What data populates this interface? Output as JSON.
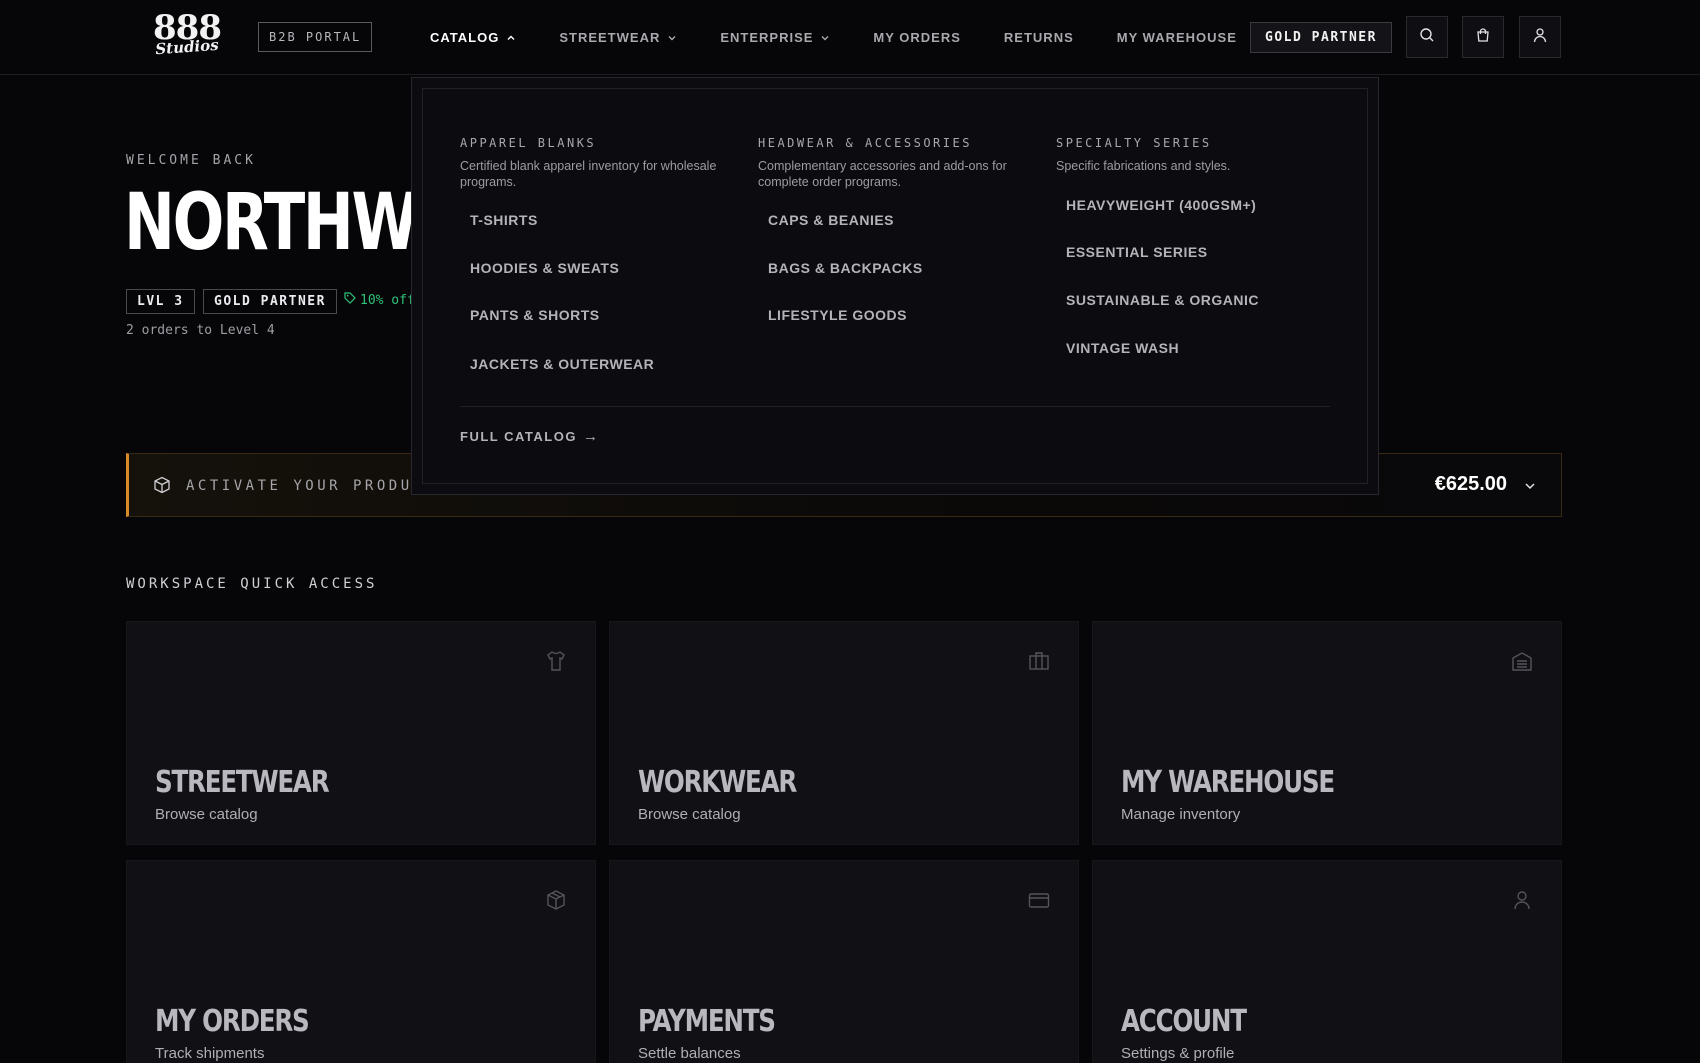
{
  "header": {
    "logo": {
      "line1": "888",
      "line2": "Studios"
    },
    "portal_badge": "B2B PORTAL",
    "nav": [
      {
        "label": "CATALOG",
        "has_dropdown": true,
        "open": true
      },
      {
        "label": "STREETWEAR",
        "has_dropdown": true
      },
      {
        "label": "ENTERPRISE",
        "has_dropdown": true
      },
      {
        "label": "MY ORDERS"
      },
      {
        "label": "RETURNS"
      },
      {
        "label": "MY WAREHOUSE"
      }
    ],
    "partner_button": "GOLD PARTNER",
    "icons": [
      "search-icon",
      "cart-icon",
      "user-icon"
    ]
  },
  "hero": {
    "welcome": "WELCOME BACK",
    "company": "NORTHWINI",
    "level_chip": "LVL 3",
    "tier_chip": "GOLD PARTNER",
    "discount": "10% off",
    "progress": "2 orders to Level 4"
  },
  "activation": {
    "label": "ACTIVATE YOUR PRODUCTI",
    "amount": "€625.00",
    "accent": "#d88a2b"
  },
  "quick_access": {
    "title": "WORKSPACE QUICK ACCESS",
    "tiles": [
      {
        "title": "STREETWEAR",
        "sub": "Browse catalog",
        "icon": "tshirt-icon"
      },
      {
        "title": "WORKWEAR",
        "sub": "Browse catalog",
        "icon": "briefcase-icon"
      },
      {
        "title": "MY WAREHOUSE",
        "sub": "Manage inventory",
        "icon": "warehouse-icon"
      },
      {
        "title": "MY ORDERS",
        "sub": "Track shipments",
        "icon": "box-icon"
      },
      {
        "title": "PAYMENTS",
        "sub": "Settle balances",
        "icon": "credit-card-icon"
      },
      {
        "title": "ACCOUNT",
        "sub": "Settings & profile",
        "icon": "user-icon"
      }
    ]
  },
  "mega_menu": {
    "columns": [
      {
        "title": "APPAREL BLANKS",
        "desc": "Certified blank apparel inventory for wholesale programs.",
        "items": [
          "T-SHIRTS",
          "HOODIES & SWEATS",
          "PANTS & SHORTS",
          "JACKETS & OUTERWEAR"
        ]
      },
      {
        "title": "HEADWEAR & ACCESSORIES",
        "desc": "Complementary accessories and add-ons for complete order programs.",
        "items": [
          "CAPS & BEANIES",
          "BAGS & BACKPACKS",
          "LIFESTYLE GOODS"
        ]
      },
      {
        "title": "SPECIALTY SERIES",
        "desc": "Specific fabrications and styles.",
        "items": [
          "HEAVYWEIGHT (400GSM+)",
          "ESSENTIAL SERIES",
          "SUSTAINABLE & ORGANIC",
          "VINTAGE WASH"
        ]
      }
    ],
    "footer_link": "FULL CATALOG",
    "footer_arrow": "→"
  },
  "colors": {
    "background": "#060508",
    "accent_orange": "#d88a2b",
    "discount_green": "#2fc47a"
  }
}
